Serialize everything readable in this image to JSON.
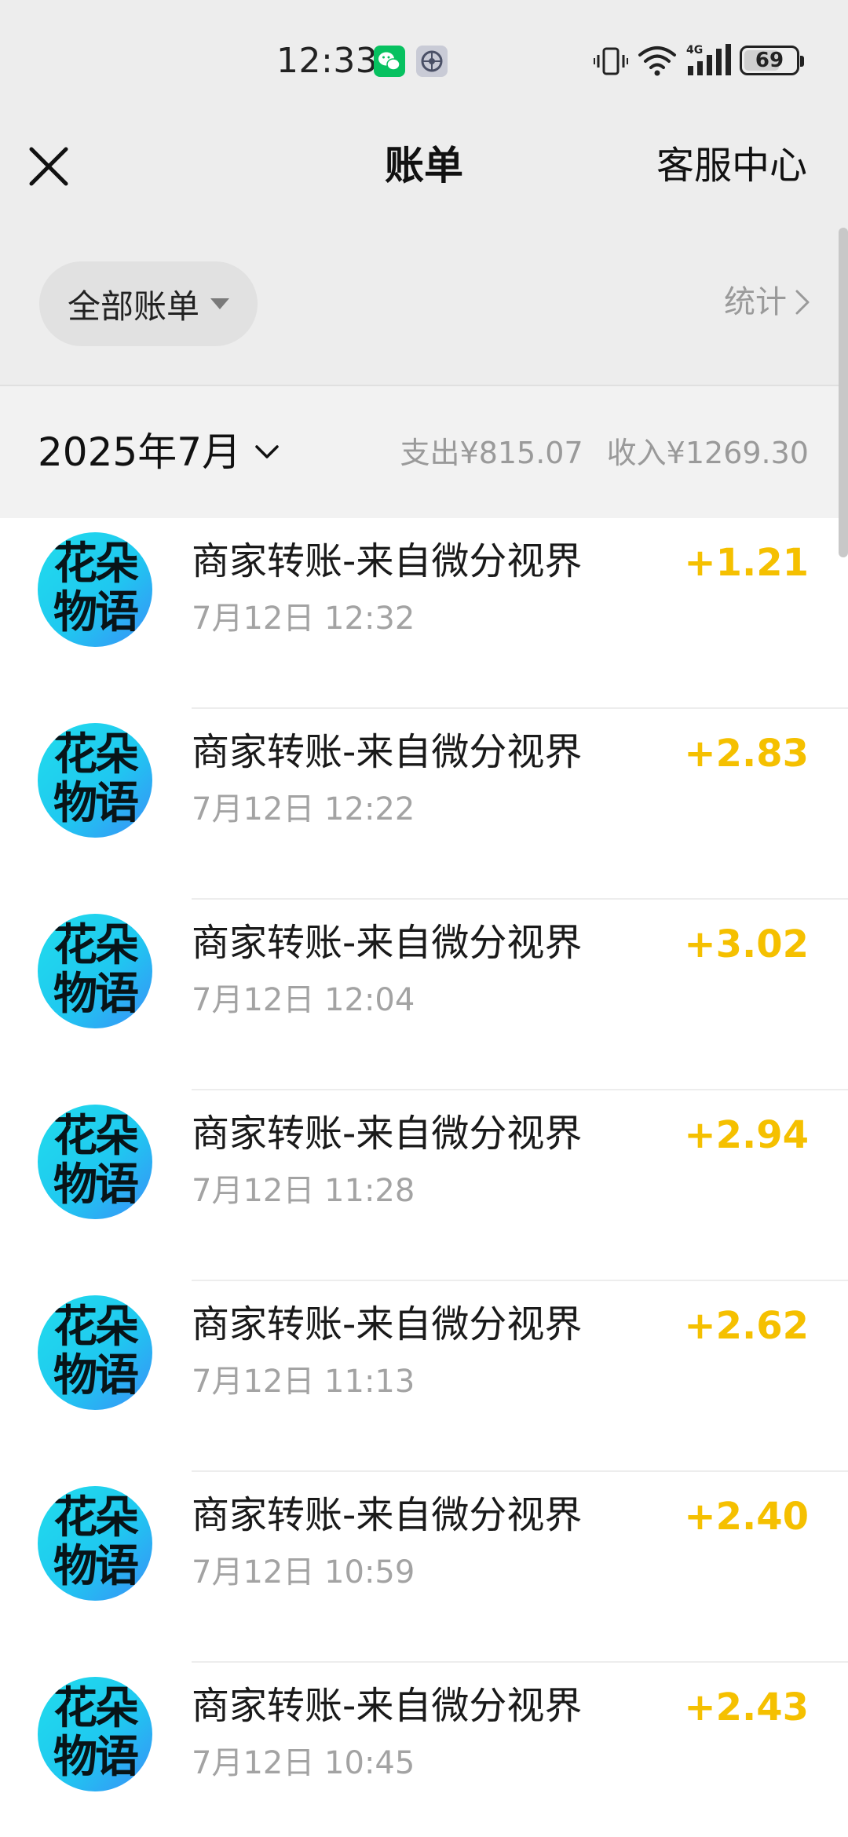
{
  "status_bar": {
    "time": "12:33",
    "battery": "69",
    "battery_level": 0.69,
    "icons": [
      "wechat-icon",
      "settings-icon",
      "vibrate-icon",
      "wifi-icon",
      "signal-4g-icon",
      "battery-icon"
    ]
  },
  "nav": {
    "title": "账单",
    "right_link": "客服中心",
    "close_icon": "close-icon"
  },
  "filter": {
    "label": "全部账单",
    "stats_label": "统计"
  },
  "month": {
    "label": "2025年7月",
    "expense_label": "支出",
    "expense_value": "¥815.07",
    "income_label": "收入",
    "income_value": "¥1269.30"
  },
  "colors": {
    "amount_income": "#f5c000",
    "background_top": "#ededed",
    "avatar_start": "#21dcec",
    "avatar_end": "#3a8ef8"
  },
  "transactions": [
    {
      "avatar": "花朵\n物语",
      "title": "商家转账-来自微分视界",
      "time": "7月12日 12:32",
      "amount": "+1.21"
    },
    {
      "avatar": "花朵\n物语",
      "title": "商家转账-来自微分视界",
      "time": "7月12日 12:22",
      "amount": "+2.83"
    },
    {
      "avatar": "花朵\n物语",
      "title": "商家转账-来自微分视界",
      "time": "7月12日 12:04",
      "amount": "+3.02"
    },
    {
      "avatar": "花朵\n物语",
      "title": "商家转账-来自微分视界",
      "time": "7月12日 11:28",
      "amount": "+2.94"
    },
    {
      "avatar": "花朵\n物语",
      "title": "商家转账-来自微分视界",
      "time": "7月12日 11:13",
      "amount": "+2.62"
    },
    {
      "avatar": "花朵\n物语",
      "title": "商家转账-来自微分视界",
      "time": "7月12日 10:59",
      "amount": "+2.40"
    },
    {
      "avatar": "花朵\n物语",
      "title": "商家转账-来自微分视界",
      "time": "7月12日 10:45",
      "amount": "+2.43"
    }
  ]
}
